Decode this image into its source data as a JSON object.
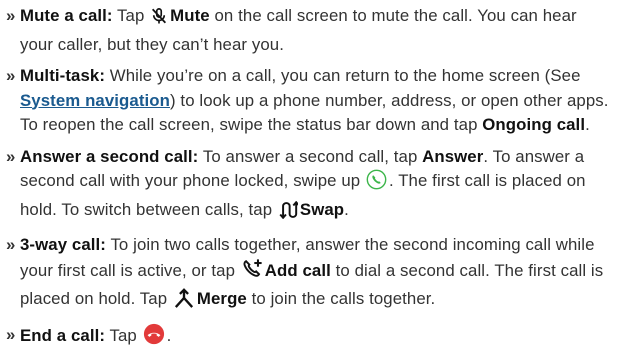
{
  "bullet": "»",
  "colors": {
    "text": "#333333",
    "bold_text": "#111111",
    "link": "#1a5a8f",
    "answer_icon": "#3cb54a",
    "end_call_icon": "#e23a3a"
  },
  "items": [
    {
      "lead": "Mute a call:",
      "text1": " Tap ",
      "icon": "mic-off-icon",
      "strong": "Mute",
      "text2": " on the call screen to mute the call. You can hear your caller, but they can’t hear you."
    },
    {
      "lead": "Multi-task:",
      "text1": " While you’re on a call, you can return to the home screen (See ",
      "link": "System navigation",
      "text2": ") to look up a phone number, address, or open other apps. To reopen the call screen, swipe the status bar down and tap ",
      "strong": "Ongoing call",
      "text3": "."
    },
    {
      "lead": "Answer a second call:",
      "text1": " To answer a second call, tap ",
      "strong1": "Answer",
      "text2": ". To answer a second call with your phone locked, swipe up ",
      "icon1": "answer-call-icon",
      "text3": ". The first call is placed on hold. To switch between calls, tap ",
      "icon2": "swap-icon",
      "strong2": "Swap",
      "text4": "."
    },
    {
      "lead": "3-way call:",
      "text1": " To join two calls together, answer the second incoming call while your first call is active, or tap ",
      "icon1": "add-call-icon",
      "strong1": "Add call",
      "text2": " to dial a second call. The first call is placed on hold. Tap ",
      "icon2": "merge-icon",
      "strong2": "Merge",
      "text3": " to join the calls together."
    },
    {
      "lead": "End a call:",
      "text1": " Tap ",
      "icon": "end-call-icon",
      "text2": "."
    }
  ]
}
